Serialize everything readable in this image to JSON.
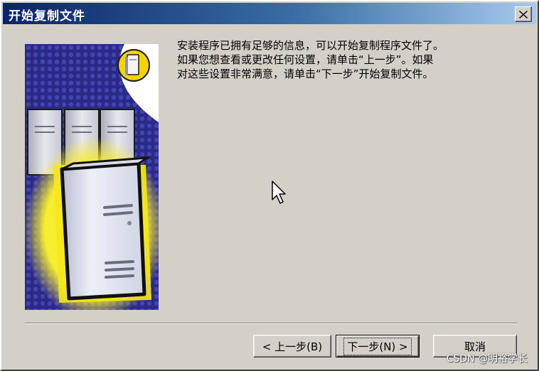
{
  "window": {
    "title": "开始复制文件"
  },
  "message": {
    "lines": [
      "安装程序已拥有足够的信息，可以开始复制程序文件了。",
      "如果您想查看或更改任何设置，请单击“上一步”。如果",
      "对这些设置非常满意，请单击“下一步”开始复制文件。"
    ]
  },
  "buttons": {
    "back": "< 上一步(B)",
    "next": "下一步(N) >",
    "cancel": "取消"
  },
  "watermark": "CSDN @明裕学长",
  "icons": {
    "close": "close-icon",
    "illustration": "server-tower-icon",
    "cursor": "mouse-pointer-icon"
  },
  "colors": {
    "title_bar_start": "#0a246a",
    "title_bar_end": "#a6caf0",
    "dialog_face": "#d4d0c8",
    "illustration_navy": "#2a2a86",
    "glow_yellow": "#f5e81a"
  }
}
